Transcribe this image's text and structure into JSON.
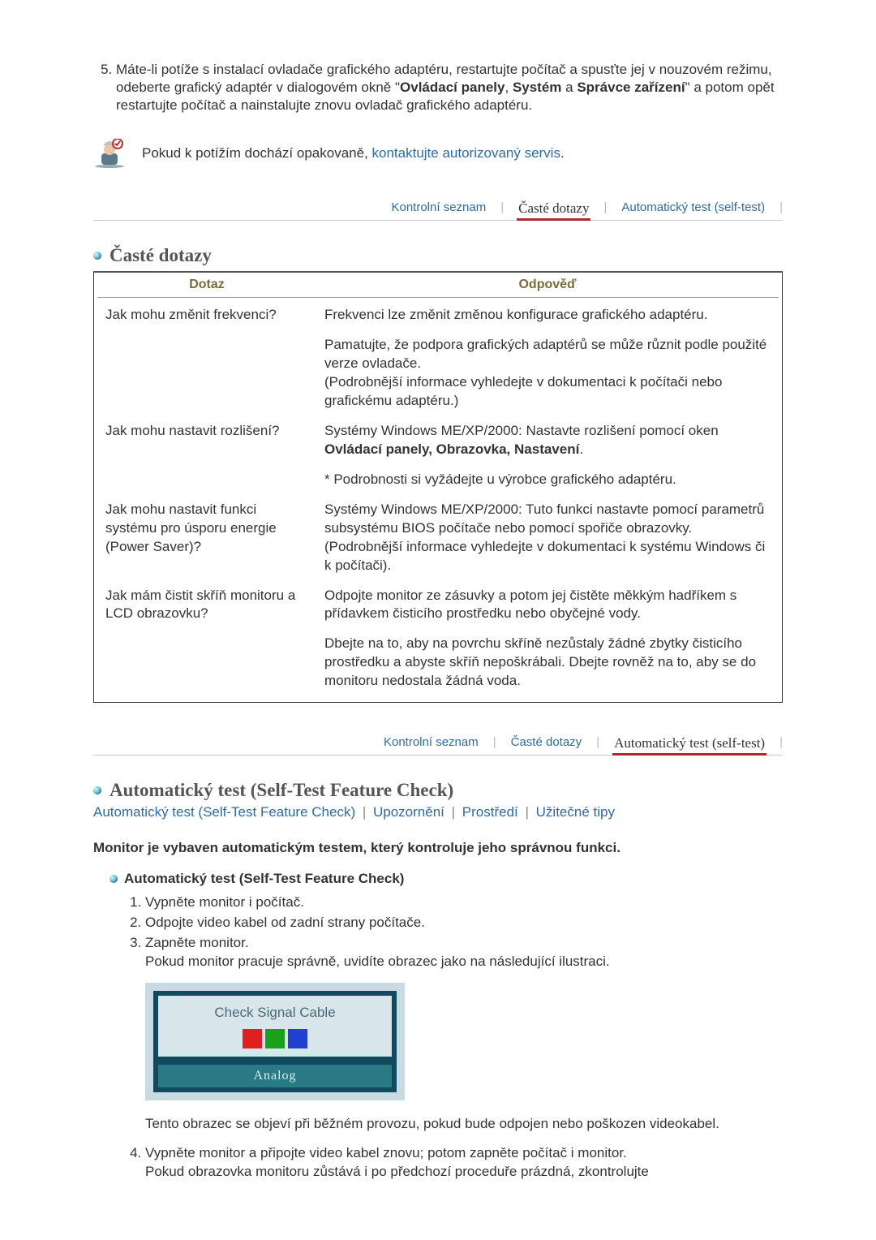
{
  "top_item": {
    "number": 5,
    "prefix": "Máte-li potíže s instalací ovladače grafického adaptéru, restartujte počítač a spusťte jej v nouzovém režimu, odeberte grafický adaptér v dialogovém okně \"",
    "bold1": "Ovládací panely",
    "sep1": ", ",
    "bold2": "Systém",
    "mid": " a ",
    "bold3": "Správce zařízení",
    "suffix": "\" a potom opět restartujte počítač a nainstalujte znovu ovladač grafického adaptéru."
  },
  "note": {
    "text_before": "Pokud k potížím dochází opakovaně, ",
    "link": "kontaktujte autorizovaný servis",
    "text_after": "."
  },
  "tabs": {
    "left": "Kontrolní seznam",
    "mid": "Časté dotazy",
    "right": "Automatický test (self-test)"
  },
  "faq": {
    "title": "Časté dotazy",
    "head_q": "Dotaz",
    "head_a": "Odpověď",
    "rows": [
      {
        "q": "Jak mohu změnit frekvenci?",
        "a": "Frekvenci lze změnit změnou konfigurace grafického adaptéru."
      },
      {
        "q": "",
        "a": "Pamatujte, že podpora grafických adaptérů se může různit podle použité verze ovladače.\n(Podrobnější informace vyhledejte v dokumentaci k počítači nebo grafickému adaptéru.)"
      },
      {
        "q": "Jak mohu nastavit rozlišení?",
        "a_prefix": "Systémy Windows ME/XP/2000: Nastavte rozlišení pomocí oken ",
        "a_bold": "Ovládací panely, Obrazovka, Nastavení",
        "a_suffix": "."
      },
      {
        "q": "",
        "a": "* Podrobnosti si vyžádejte u výrobce grafického adaptéru."
      },
      {
        "q": "Jak mohu nastavit funkci systému pro úsporu energie (Power Saver)?",
        "a": "Systémy Windows ME/XP/2000: Tuto funkci nastavte pomocí parametrů subsystému BIOS počítače nebo pomocí spořiče obrazovky. (Podrobnější informace vyhledejte v dokumentaci k systému Windows či k počítači)."
      },
      {
        "q": "Jak mám čistit skříň monitoru a LCD obrazovku?",
        "a": "Odpojte monitor ze zásuvky a potom jej čistěte měkkým hadříkem s přídavkem čisticího prostředku nebo obyčejné vody."
      },
      {
        "q": "",
        "a": "Dbejte na to, aby na povrchu skříně nezůstaly žádné zbytky čisticího prostředku a abyste skříň nepoškrábali. Dbejte rovněž na to, aby se do monitoru nedostala žádná voda."
      }
    ]
  },
  "selftest": {
    "title": "Automatický test (Self-Test Feature Check)",
    "links": [
      "Automatický test (Self-Test Feature Check)",
      "Upozornění",
      "Prostředí",
      "Užitečné tipy"
    ],
    "intro": "Monitor je vybaven automatickým testem, který kontroluje jeho správnou funkci.",
    "subhead": "Automatický test (Self-Test Feature Check)",
    "steps": {
      "s1": "Vypněte monitor i počítač.",
      "s2": "Odpojte video kabel od zadní strany počítače.",
      "s3": "Zapněte monitor.",
      "s3b": "Pokud monitor pracuje správně, uvidíte obrazec jako na následující ilustraci.",
      "signal_label": "Check Signal Cable",
      "signal_footer": "Analog",
      "after_box": "Tento obrazec se objeví při běžném provozu, pokud bude odpojen nebo poškozen videokabel.",
      "s4": "Vypněte monitor a připojte video kabel znovu; potom zapněte počítač i monitor.",
      "s4b": "Pokud obrazovka monitoru zůstává i po předchozí proceduře prázdná, zkontrolujte"
    }
  }
}
